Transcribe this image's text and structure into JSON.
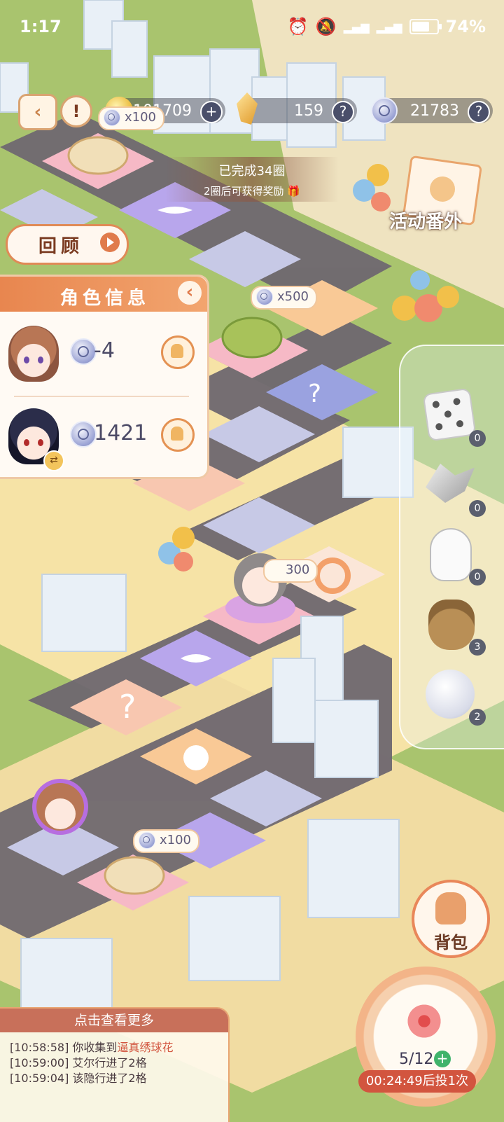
{
  "status_bar": {
    "time": "1:17",
    "battery": "74%"
  },
  "currencies": [
    {
      "value": "101709",
      "action": "+"
    },
    {
      "value": "159",
      "action": "?"
    },
    {
      "value": "21783",
      "action": "?"
    }
  ],
  "banner": {
    "line1": "已完成34圈",
    "line2": "2圈后可获得奖励"
  },
  "review_button": "回顾",
  "activity_label": "活动番外",
  "role_panel": {
    "title": "角色信息",
    "rows": [
      {
        "value": "-4"
      },
      {
        "value": "1421"
      }
    ]
  },
  "board_chips": [
    "x100",
    "x500",
    "300",
    "x100"
  ],
  "items": [
    {
      "name": "dice-icon",
      "count": "0"
    },
    {
      "name": "shard-icon",
      "count": "0"
    },
    {
      "name": "glove-icon",
      "count": "0"
    },
    {
      "name": "bag-icon",
      "count": "3"
    },
    {
      "name": "snowball-icon",
      "count": "2"
    }
  ],
  "backpack_label": "背包",
  "dice_counter": "5/12",
  "timer": "00:24:49后投1次",
  "log": {
    "header": "点击查看更多",
    "lines": [
      {
        "time": "[10:58:58]",
        "text": " 你收集到",
        "highlight": "逼真绣球花"
      },
      {
        "time": "[10:59:00]",
        "text": " 艾尔行进了2格",
        "highlight": ""
      },
      {
        "time": "[10:59:04]",
        "text": " 该隐行进了2格",
        "highlight": ""
      }
    ]
  },
  "colors": {
    "accent": "#e9875a",
    "grass": "#a9c46e",
    "road": "#6f6870",
    "timer": "#d2553f"
  }
}
